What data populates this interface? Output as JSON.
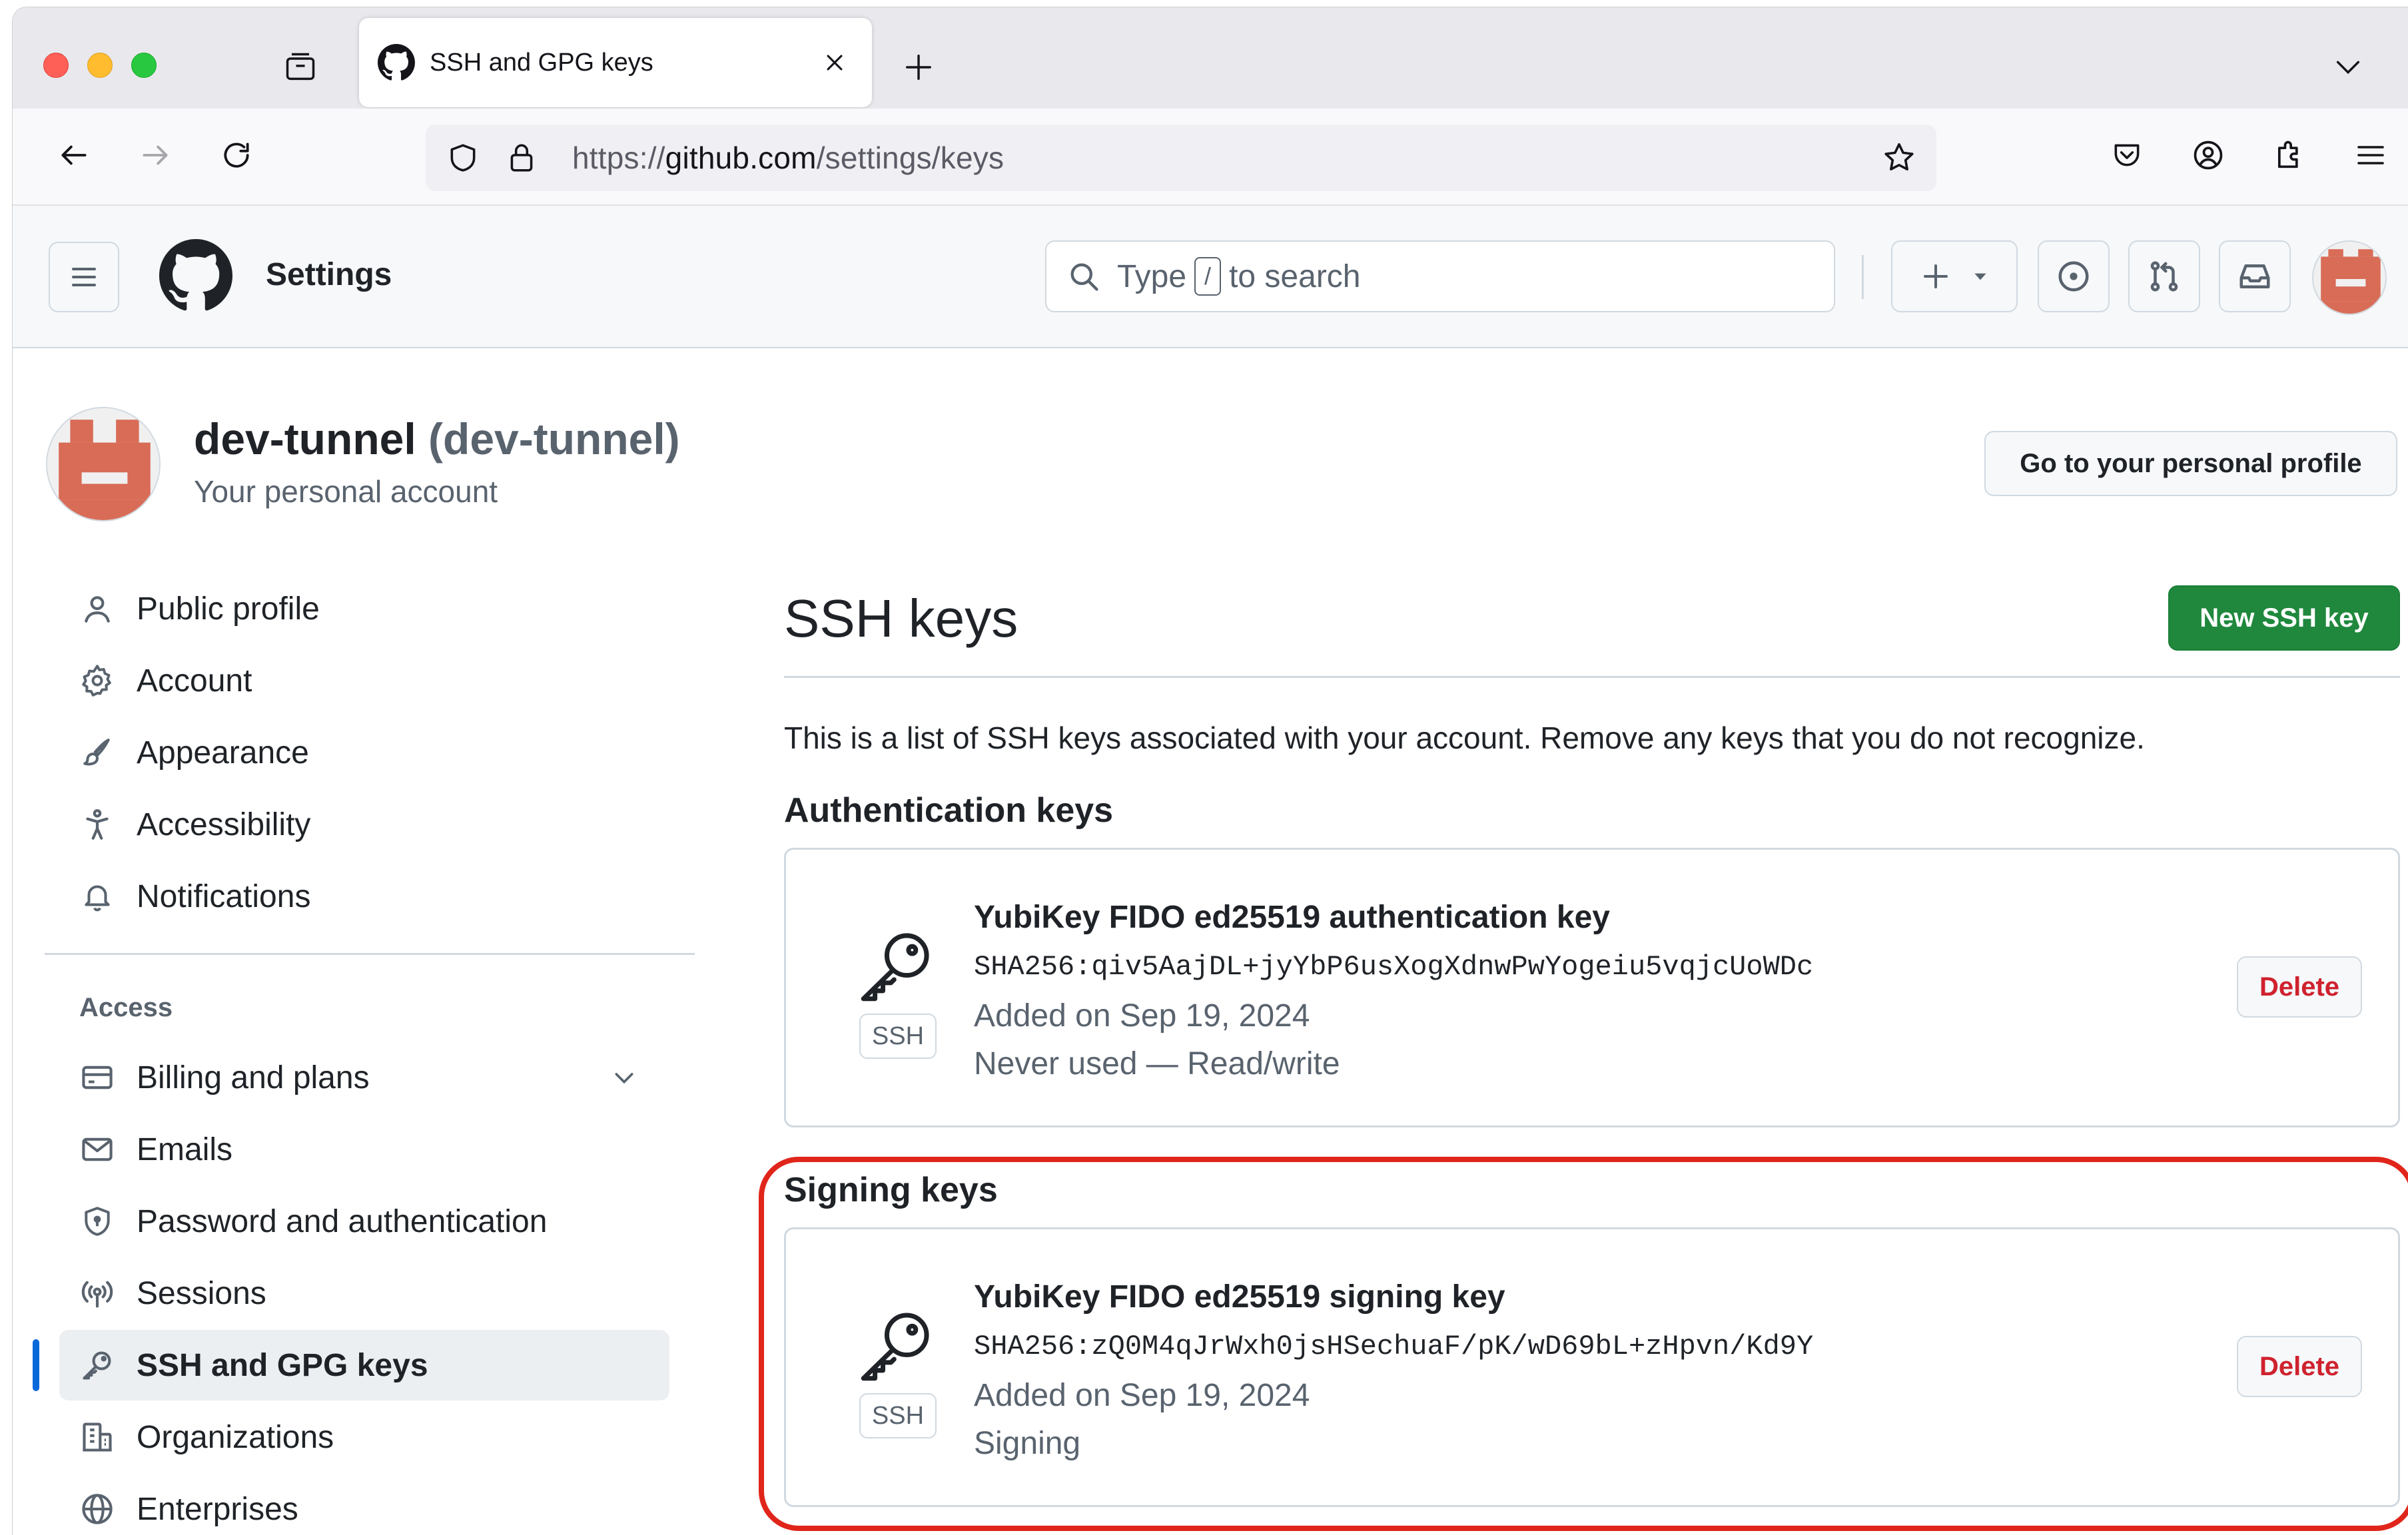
{
  "browser": {
    "tab_title": "SSH and GPG keys",
    "url_scheme": "https://",
    "url_host": "github.com",
    "url_path": "/settings/keys"
  },
  "header": {
    "context_title": "Settings",
    "search_prefix": "Type",
    "search_key": "/",
    "search_suffix": "to search"
  },
  "user": {
    "name": "dev-tunnel",
    "login": "(dev-tunnel)",
    "subtitle": "Your personal account",
    "profile_button": "Go to your personal profile"
  },
  "sidebar": {
    "items": [
      {
        "label": "Public profile",
        "icon": "person-icon"
      },
      {
        "label": "Account",
        "icon": "gear-icon"
      },
      {
        "label": "Appearance",
        "icon": "paintbrush-icon"
      },
      {
        "label": "Accessibility",
        "icon": "accessibility-icon"
      },
      {
        "label": "Notifications",
        "icon": "bell-icon"
      }
    ],
    "group_label": "Access",
    "access_items": [
      {
        "label": "Billing and plans",
        "icon": "credit-card-icon"
      },
      {
        "label": "Emails",
        "icon": "mail-icon"
      },
      {
        "label": "Password and authentication",
        "icon": "shield-lock-icon"
      },
      {
        "label": "Sessions",
        "icon": "broadcast-icon"
      },
      {
        "label": "SSH and GPG keys",
        "icon": "key-icon",
        "active": true
      },
      {
        "label": "Organizations",
        "icon": "organization-icon"
      },
      {
        "label": "Enterprises",
        "icon": "globe-icon"
      }
    ]
  },
  "main": {
    "title": "SSH keys",
    "new_button": "New SSH key",
    "intro": "This is a list of SSH keys associated with your account. Remove any keys that you do not recognize.",
    "auth_heading": "Authentication keys",
    "signing_heading": "Signing keys",
    "auth_key": {
      "title": "YubiKey FIDO ed25519 authentication key",
      "fingerprint": "SHA256:qiv5AajDL+jyYbP6usXogXdnwPwYogeiu5vqjcUoWDc",
      "added": "Added on Sep 19, 2024",
      "usage": "Never used — Read/write",
      "badge": "SSH",
      "delete": "Delete"
    },
    "signing_key": {
      "title": "YubiKey FIDO ed25519 signing key",
      "fingerprint": "SHA256:zQ0M4qJrWxh0jsHSechuaF/pK/wD69bL+zHpvn/Kd9Y",
      "added": "Added on Sep 19, 2024",
      "usage": "Signing",
      "badge": "SSH",
      "delete": "Delete"
    }
  },
  "colors": {
    "accent_green": "#1f883d",
    "danger_red": "#cf222e",
    "highlight_red": "#e0251b",
    "active_blue": "#0969da"
  }
}
